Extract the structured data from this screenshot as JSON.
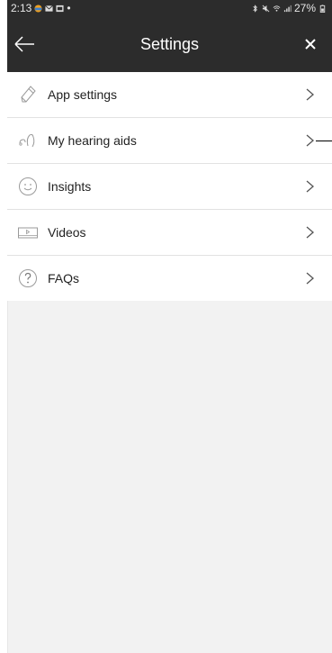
{
  "status_bar": {
    "time": "2:13",
    "battery": "27%"
  },
  "header": {
    "title": "Settings",
    "back_icon": "arrow-left-icon",
    "close_icon": "close-icon"
  },
  "menu": [
    {
      "label": "App settings",
      "icon": "pencil-icon"
    },
    {
      "label": "My hearing aids",
      "icon": "hearing-aids-icon"
    },
    {
      "label": "Insights",
      "icon": "smiley-icon"
    },
    {
      "label": "Videos",
      "icon": "video-icon"
    },
    {
      "label": "FAQs",
      "icon": "question-icon"
    }
  ],
  "colors": {
    "header_bg": "#2c2c2c",
    "page_bg": "#f2f2f2",
    "divider": "#e2e2e2"
  }
}
